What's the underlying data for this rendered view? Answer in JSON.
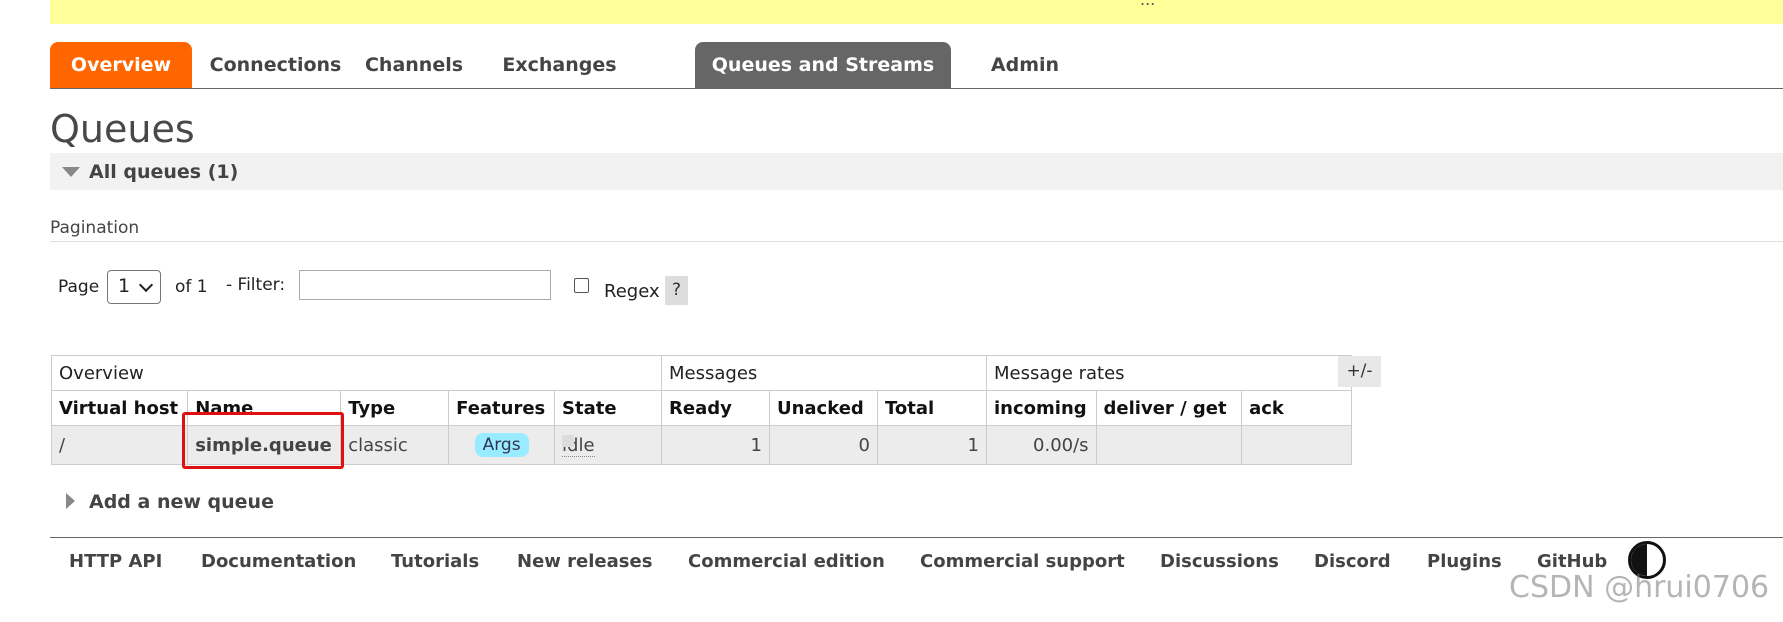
{
  "banner": {
    "text": "..."
  },
  "nav": {
    "tabs": [
      {
        "label": "Overview"
      },
      {
        "label": "Connections"
      },
      {
        "label": "Channels"
      },
      {
        "label": "Exchanges"
      },
      {
        "label": "Queues and Streams"
      },
      {
        "label": "Admin"
      }
    ],
    "active_tab": "Queues and Streams",
    "active_color": "#666666",
    "overview_color": "#ff6600"
  },
  "page": {
    "title": "Queues"
  },
  "section": {
    "title": "All queues (1)"
  },
  "pagination": {
    "label": "Pagination",
    "page_label": "Page",
    "page_value": "1",
    "of_label": "of 1",
    "filter_label": "- Filter:",
    "filter_value": "",
    "regex_label": "Regex",
    "regex_checked": false,
    "help_label": "?"
  },
  "table": {
    "groups": [
      "Overview",
      "Messages",
      "Message rates"
    ],
    "headers": [
      "Virtual host",
      "Name",
      "Type",
      "Features",
      "State",
      "Ready",
      "Unacked",
      "Total",
      "incoming",
      "deliver / get",
      "ack"
    ],
    "rows": [
      {
        "vhost": "/",
        "name": "simple.queue",
        "type": "classic",
        "features": "Args",
        "state": "idle",
        "ready": "1",
        "unacked": "0",
        "total": "1",
        "incoming": "0.00/s",
        "deliver_get": "",
        "ack": ""
      }
    ],
    "columns_toggle": "+/-"
  },
  "add_queue": {
    "label": "Add a new queue"
  },
  "footer": {
    "links": [
      "HTTP API",
      "Documentation",
      "Tutorials",
      "New releases",
      "Commercial edition",
      "Commercial support",
      "Discussions",
      "Discord",
      "Plugins",
      "GitHub"
    ]
  },
  "watermark": "CSDN @hrui0706",
  "highlight_color": "#e01010"
}
